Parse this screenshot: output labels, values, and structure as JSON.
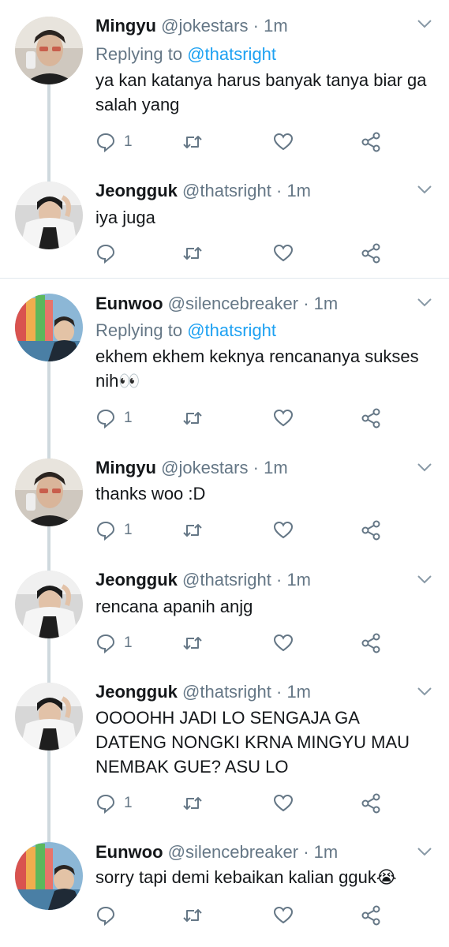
{
  "tweets": [
    {
      "name": "Mingyu",
      "handle": "@jokestars",
      "dot": "·",
      "time": "1m",
      "replying_to_prefix": "Replying to",
      "replying_to": "@thatsright",
      "text": "ya kan katanya harus banyak tanya biar ga salah yang",
      "reply_count": "1",
      "avatar": "mingyu"
    },
    {
      "name": "Jeongguk",
      "handle": "@thatsright",
      "dot": "·",
      "time": "1m",
      "text": "iya juga",
      "reply_count": "",
      "avatar": "jeongguk"
    },
    {
      "name": "Eunwoo",
      "handle": "@silencebreaker",
      "dot": "·",
      "time": "1m",
      "replying_to_prefix": "Replying to",
      "replying_to": "@thatsright",
      "text": "ekhem ekhem keknya rencananya sukses nih👀",
      "reply_count": "1",
      "avatar": "eunwoo"
    },
    {
      "name": "Mingyu",
      "handle": "@jokestars",
      "dot": "·",
      "time": "1m",
      "text": "thanks woo :D",
      "reply_count": "1",
      "avatar": "mingyu"
    },
    {
      "name": "Jeongguk",
      "handle": "@thatsright",
      "dot": "·",
      "time": "1m",
      "text": "rencana apanih anjg",
      "reply_count": "1",
      "avatar": "jeongguk"
    },
    {
      "name": "Jeongguk",
      "handle": "@thatsright",
      "dot": "·",
      "time": "1m",
      "text": "OOOOHH JADI LO SENGAJA GA DATENG NONGKI KRNA MINGYU MAU NEMBAK GUE? ASU LO",
      "reply_count": "1",
      "avatar": "jeongguk"
    },
    {
      "name": "Eunwoo",
      "handle": "@silencebreaker",
      "dot": "·",
      "time": "1m",
      "text": "sorry tapi demi kebaikan kalian gguk😭",
      "reply_count": "",
      "avatar": "eunwoo"
    }
  ],
  "colors": {
    "accent": "#1da1f2",
    "secondary_text": "#657786",
    "thread_line": "#cfd9de",
    "divider": "#e1e8ed"
  },
  "icons": {
    "reply": "reply-icon",
    "retweet": "retweet-icon",
    "like": "like-icon",
    "share": "share-icon",
    "caret": "chevron-down-icon"
  }
}
